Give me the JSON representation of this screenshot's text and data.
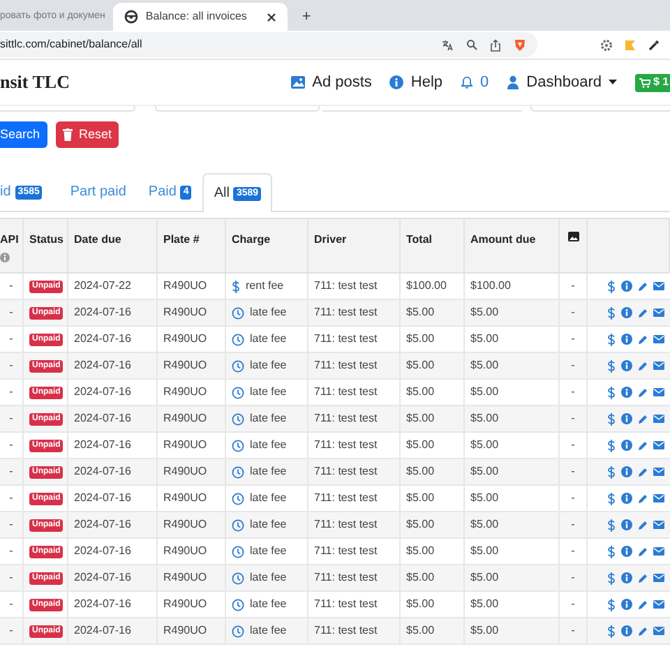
{
  "browser": {
    "tabs": [
      {
        "title": "ровать фото и докумен",
        "selected": false
      },
      {
        "title": "Balance: all invoices",
        "selected": true
      }
    ],
    "new_tab": "+",
    "url": "sittlc.com/cabinet/balance/all"
  },
  "navbar": {
    "brand": "nsit TLC",
    "links": [
      {
        "kind": "ads",
        "label": "Ad posts"
      },
      {
        "kind": "help",
        "label": "Help"
      },
      {
        "kind": "bell",
        "label": "0"
      },
      {
        "kind": "user",
        "label": "Dashboard"
      }
    ],
    "cart": "$ 1"
  },
  "buttons": [
    {
      "kind": "search",
      "label": "Search"
    },
    {
      "kind": "reset",
      "label": "Reset"
    }
  ],
  "tabs": [
    {
      "label": "id",
      "count": "3585",
      "selected": false
    },
    {
      "label": "Part paid",
      "selected": false
    },
    {
      "label": "Paid",
      "count": "4",
      "selected": false
    },
    {
      "label": "All",
      "count": "3589",
      "selected": true
    }
  ],
  "table": {
    "columns": [
      {
        "kind": "api",
        "label": "API"
      },
      {
        "kind": "text",
        "label": "Status"
      },
      {
        "kind": "text",
        "label": "Date due"
      },
      {
        "kind": "text",
        "label": "Plate #"
      },
      {
        "kind": "text",
        "label": "Charge"
      },
      {
        "kind": "text",
        "label": "Driver"
      },
      {
        "kind": "text",
        "label": "Total"
      },
      {
        "kind": "text",
        "label": "Amount due"
      },
      {
        "kind": "image"
      },
      {
        "kind": "actions"
      }
    ],
    "rows": [
      {
        "api": "-",
        "status": "Unpaid",
        "date": "2024-07-22",
        "plate": "R490UO",
        "charge": {
          "kind": "rent",
          "label": "rent fee"
        },
        "driver": "711: test test",
        "total": "$100.00",
        "amount_due": "$100.00",
        "image": "-"
      },
      {
        "api": "-",
        "status": "Unpaid",
        "date": "2024-07-16",
        "plate": "R490UO",
        "charge": {
          "kind": "late",
          "label": "late fee"
        },
        "driver": "711: test test",
        "total": "$5.00",
        "amount_due": "$5.00",
        "image": "-"
      },
      {
        "api": "-",
        "status": "Unpaid",
        "date": "2024-07-16",
        "plate": "R490UO",
        "charge": {
          "kind": "late",
          "label": "late fee"
        },
        "driver": "711: test test",
        "total": "$5.00",
        "amount_due": "$5.00",
        "image": "-"
      },
      {
        "api": "-",
        "status": "Unpaid",
        "date": "2024-07-16",
        "plate": "R490UO",
        "charge": {
          "kind": "late",
          "label": "late fee"
        },
        "driver": "711: test test",
        "total": "$5.00",
        "amount_due": "$5.00",
        "image": "-"
      },
      {
        "api": "-",
        "status": "Unpaid",
        "date": "2024-07-16",
        "plate": "R490UO",
        "charge": {
          "kind": "late",
          "label": "late fee"
        },
        "driver": "711: test test",
        "total": "$5.00",
        "amount_due": "$5.00",
        "image": "-"
      },
      {
        "api": "-",
        "status": "Unpaid",
        "date": "2024-07-16",
        "plate": "R490UO",
        "charge": {
          "kind": "late",
          "label": "late fee"
        },
        "driver": "711: test test",
        "total": "$5.00",
        "amount_due": "$5.00",
        "image": "-"
      },
      {
        "api": "-",
        "status": "Unpaid",
        "date": "2024-07-16",
        "plate": "R490UO",
        "charge": {
          "kind": "late",
          "label": "late fee"
        },
        "driver": "711: test test",
        "total": "$5.00",
        "amount_due": "$5.00",
        "image": "-"
      },
      {
        "api": "-",
        "status": "Unpaid",
        "date": "2024-07-16",
        "plate": "R490UO",
        "charge": {
          "kind": "late",
          "label": "late fee"
        },
        "driver": "711: test test",
        "total": "$5.00",
        "amount_due": "$5.00",
        "image": "-"
      },
      {
        "api": "-",
        "status": "Unpaid",
        "date": "2024-07-16",
        "plate": "R490UO",
        "charge": {
          "kind": "late",
          "label": "late fee"
        },
        "driver": "711: test test",
        "total": "$5.00",
        "amount_due": "$5.00",
        "image": "-"
      },
      {
        "api": "-",
        "status": "Unpaid",
        "date": "2024-07-16",
        "plate": "R490UO",
        "charge": {
          "kind": "late",
          "label": "late fee"
        },
        "driver": "711: test test",
        "total": "$5.00",
        "amount_due": "$5.00",
        "image": "-"
      },
      {
        "api": "-",
        "status": "Unpaid",
        "date": "2024-07-16",
        "plate": "R490UO",
        "charge": {
          "kind": "late",
          "label": "late fee"
        },
        "driver": "711: test test",
        "total": "$5.00",
        "amount_due": "$5.00",
        "image": "-"
      },
      {
        "api": "-",
        "status": "Unpaid",
        "date": "2024-07-16",
        "plate": "R490UO",
        "charge": {
          "kind": "late",
          "label": "late fee"
        },
        "driver": "711: test test",
        "total": "$5.00",
        "amount_due": "$5.00",
        "image": "-"
      },
      {
        "api": "-",
        "status": "Unpaid",
        "date": "2024-07-16",
        "plate": "R490UO",
        "charge": {
          "kind": "late",
          "label": "late fee"
        },
        "driver": "711: test test",
        "total": "$5.00",
        "amount_due": "$5.00",
        "image": "-"
      },
      {
        "api": "-",
        "status": "Unpaid",
        "date": "2024-07-16",
        "plate": "R490UO",
        "charge": {
          "kind": "late",
          "label": "late fee"
        },
        "driver": "711: test test",
        "total": "$5.00",
        "amount_due": "$5.00",
        "image": "-"
      }
    ]
  }
}
